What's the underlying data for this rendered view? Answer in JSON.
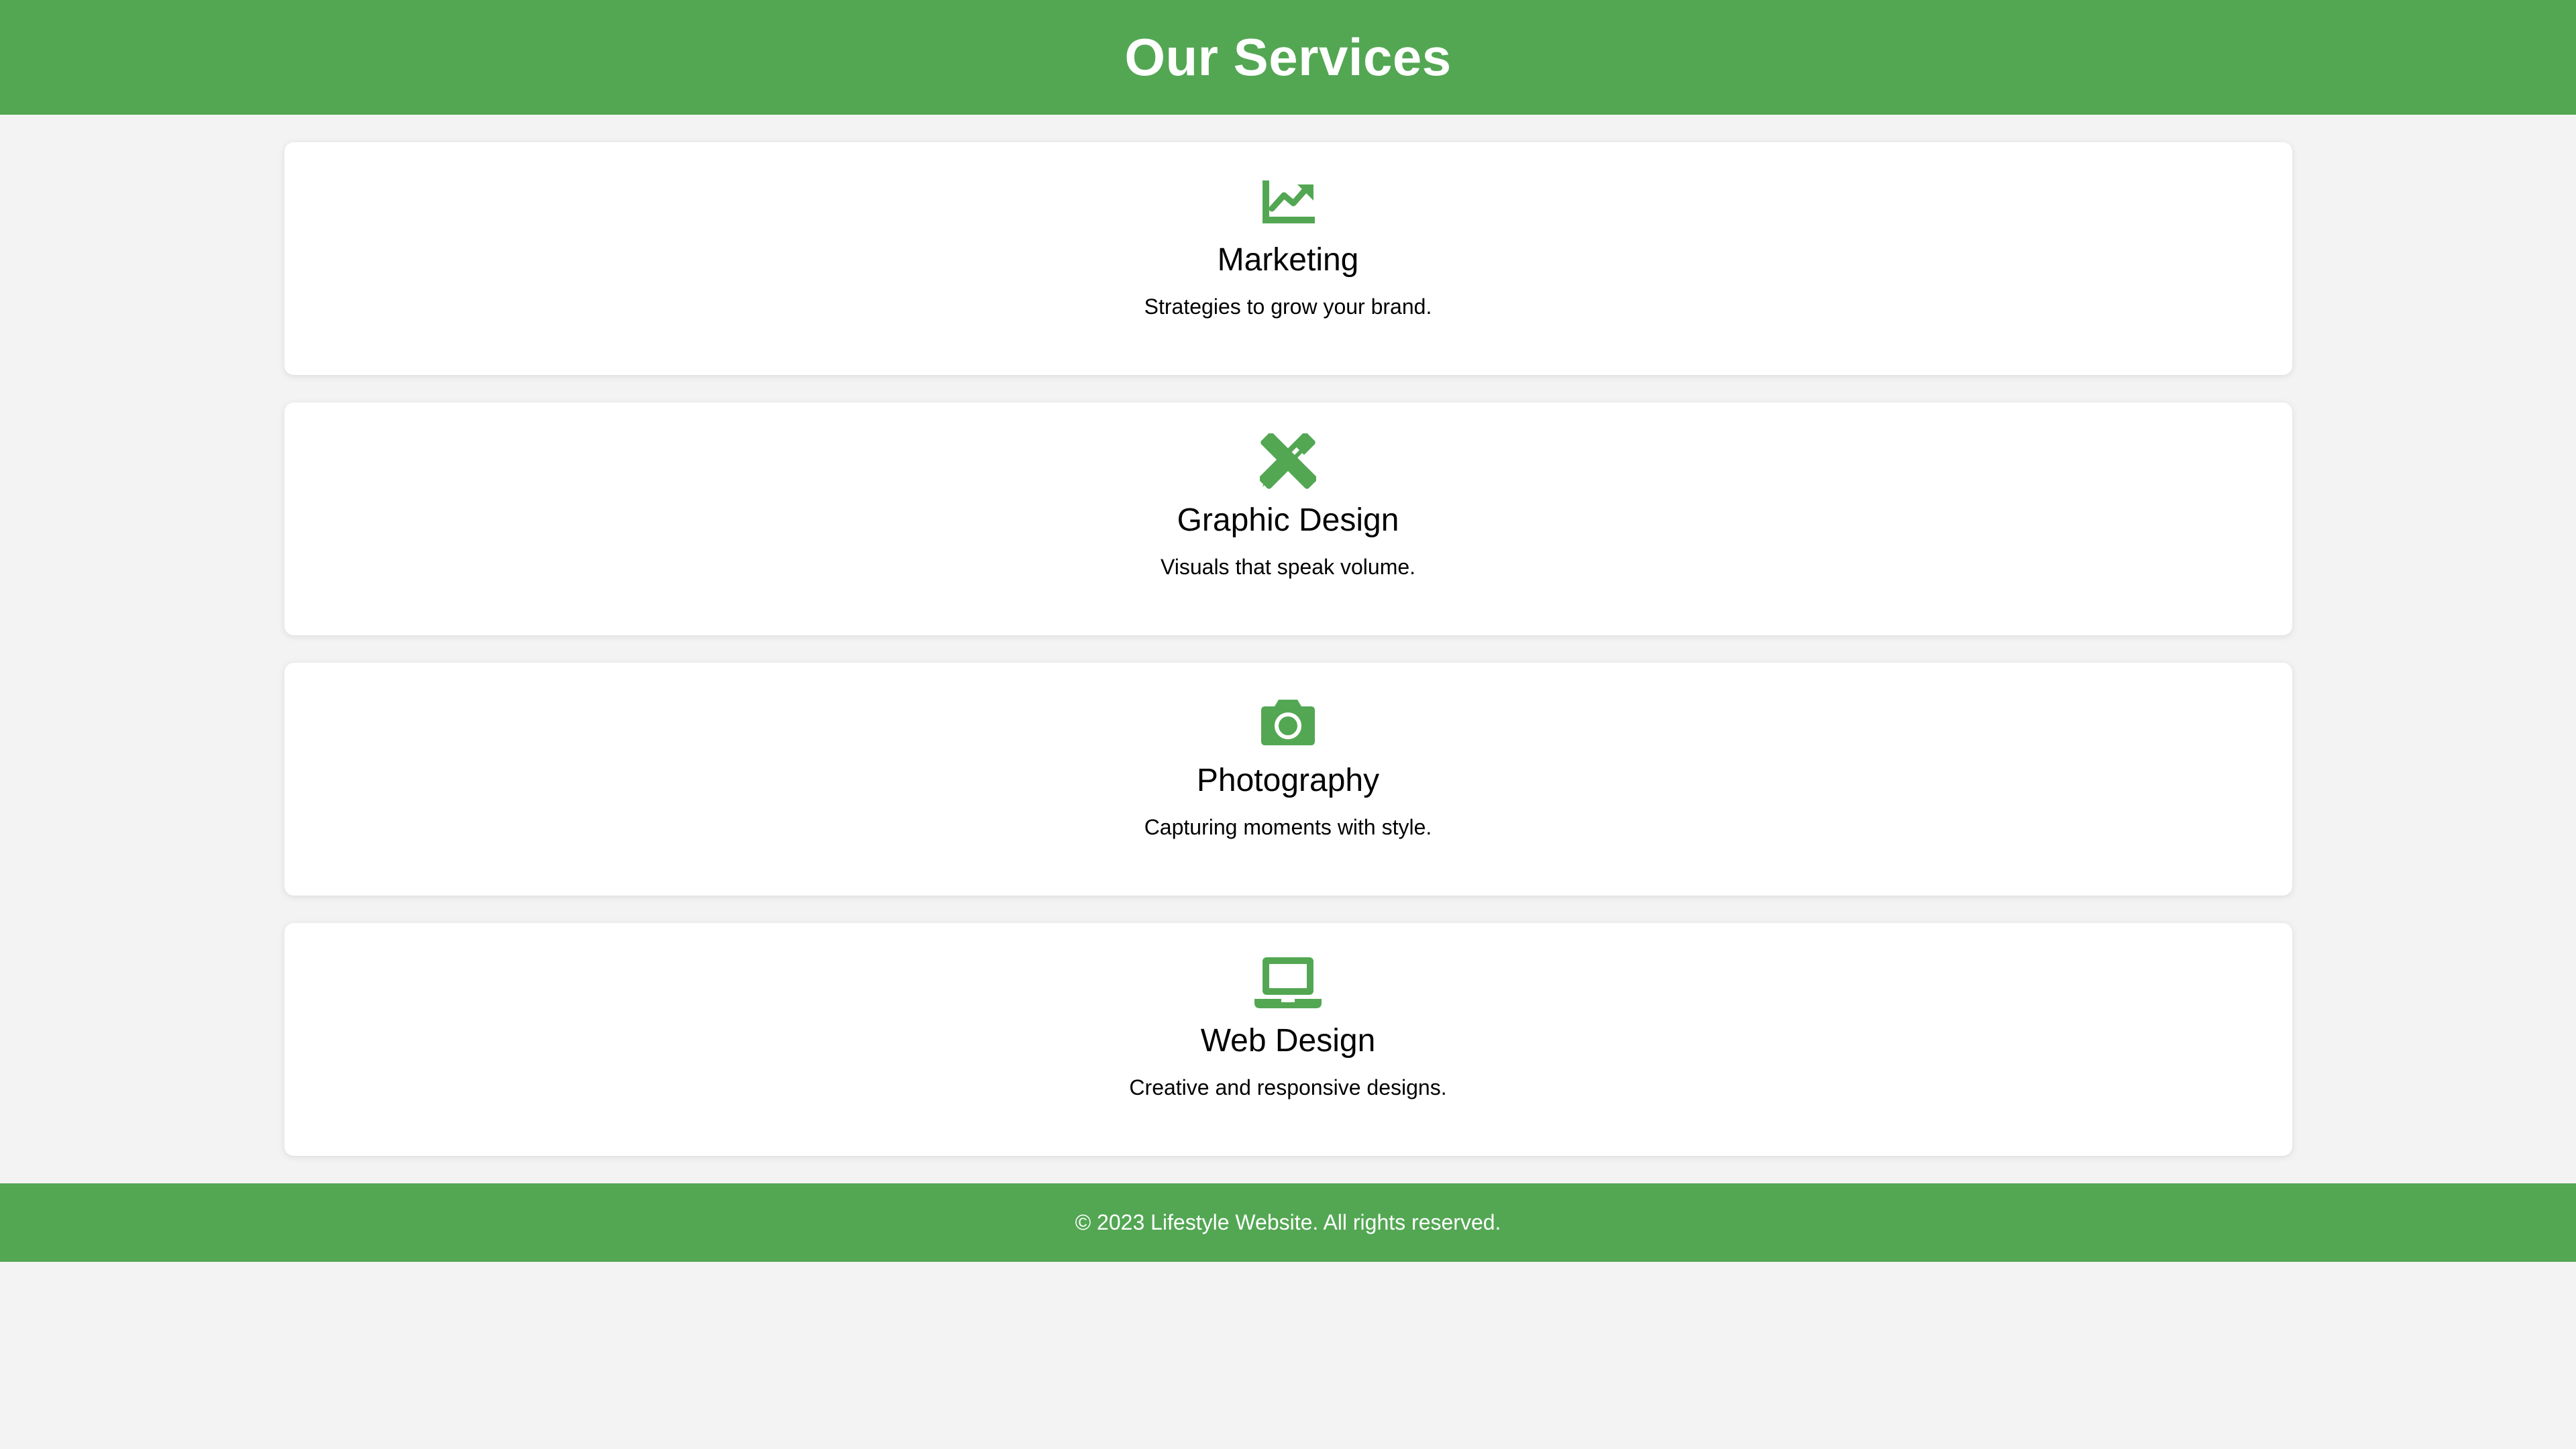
{
  "header": {
    "title": "Our Services"
  },
  "colors": {
    "accent": "#53a753",
    "background": "#f3f3f3",
    "card": "#ffffff"
  },
  "services": [
    {
      "icon": "chart-line-icon",
      "title": "Marketing",
      "description": "Strategies to grow your brand."
    },
    {
      "icon": "pencil-ruler-icon",
      "title": "Graphic Design",
      "description": "Visuals that speak volume."
    },
    {
      "icon": "camera-icon",
      "title": "Photography",
      "description": "Capturing moments with style."
    },
    {
      "icon": "laptop-icon",
      "title": "Web Design",
      "description": "Creative and responsive designs."
    }
  ],
  "footer": {
    "text": "© 2023 Lifestyle Website. All rights reserved."
  }
}
